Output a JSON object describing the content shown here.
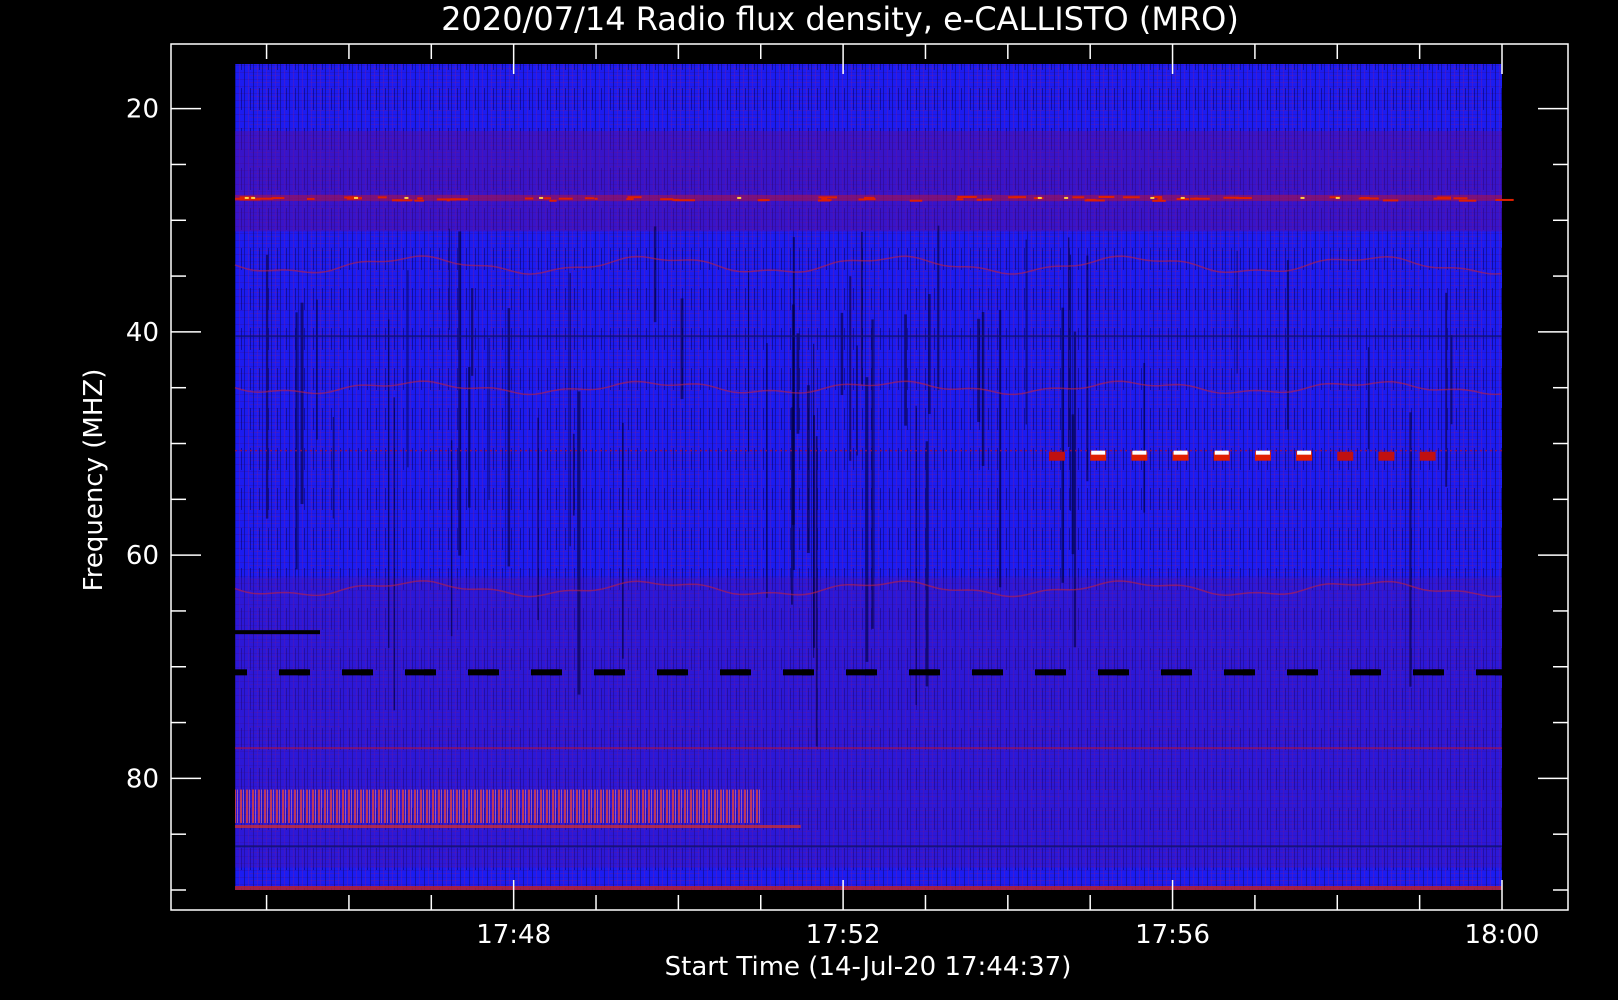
{
  "chart_data": {
    "type": "heatmap",
    "title": "2020/07/14  Radio flux density, e-CALLISTO (MRO)",
    "xlabel": "Start Time (14-Jul-20 17:44:37)",
    "ylabel": "Frequency (MHZ)",
    "x_start": "17:44:37",
    "x_range": [
      "17:44:37",
      "18:00:00"
    ],
    "x_ticks": [
      {
        "label": "17:48",
        "value": "17:48"
      },
      {
        "label": "17:52",
        "value": "17:52"
      },
      {
        "label": "17:56",
        "value": "17:56"
      },
      {
        "label": "18:00",
        "value": "18:00"
      }
    ],
    "y_range_mhz": [
      16,
      90
    ],
    "y_axis": "inverted",
    "y_ticks": [
      20,
      40,
      60,
      80
    ],
    "colorscale": "blue-red-white",
    "features": [
      {
        "kind": "red-emission-lane",
        "freq_mhz": 28
      },
      {
        "kind": "intermittent-bright-lane",
        "freq_mhz": 51,
        "time_from": "17:54:30",
        "time_to": "17:59:00"
      },
      {
        "kind": "dark-dashed-lane",
        "freq_mhz": 70.5
      },
      {
        "kind": "red-striated-band",
        "freq_mhz_from": 81,
        "freq_mhz_to": 84,
        "time_from": "17:44:37",
        "time_to": "17:51:00"
      }
    ]
  },
  "colors": {
    "background": "#000000",
    "plot_base": "#1c1cf0",
    "axis": "#ffffff",
    "emission_red": "#e02000",
    "emission_hot": "#ffffff"
  }
}
